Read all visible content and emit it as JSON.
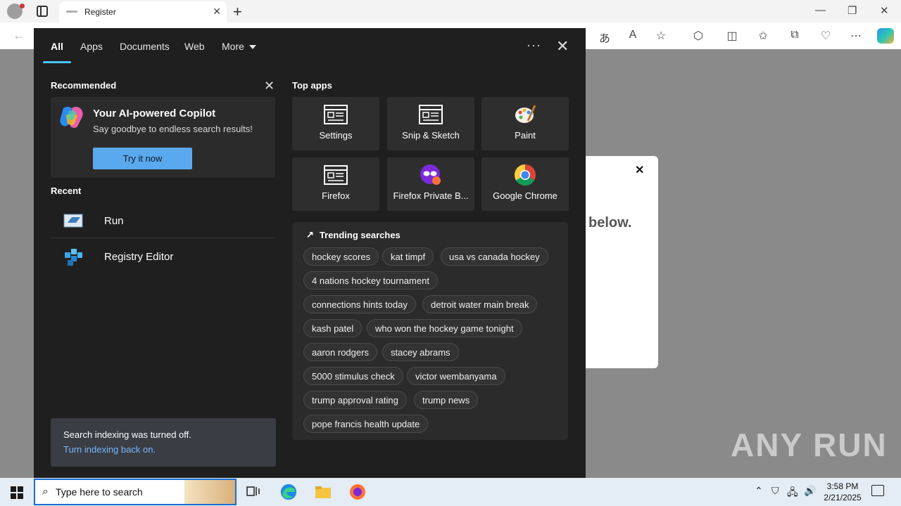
{
  "browser": {
    "tab_title": "Register",
    "colors": {
      "titlebar": "#f3f3f3",
      "toolbar": "#ffffff"
    }
  },
  "page": {
    "partial_heading": "below.",
    "close_glyph": "✕"
  },
  "search_flyout": {
    "tabs": [
      {
        "label": "All",
        "active": true
      },
      {
        "label": "Apps"
      },
      {
        "label": "Documents"
      },
      {
        "label": "Web"
      },
      {
        "label": "More"
      }
    ],
    "recommended": {
      "heading": "Recommended",
      "title": "Your AI-powered Copilot",
      "subtitle": "Say goodbye to endless search results!",
      "button_label": "Try it now"
    },
    "recent": {
      "heading": "Recent",
      "items": [
        {
          "label": "Run",
          "icon": "run-icon"
        },
        {
          "label": "Registry Editor",
          "icon": "registry-editor-icon"
        }
      ]
    },
    "indexing": {
      "message": "Search indexing was turned off.",
      "link": "Turn indexing back on."
    },
    "top_apps": {
      "heading": "Top apps",
      "items": [
        {
          "label": "Settings",
          "icon": "window-icon"
        },
        {
          "label": "Snip & Sketch",
          "icon": "window-icon"
        },
        {
          "label": "Paint",
          "icon": "paint-palette-icon"
        },
        {
          "label": "Firefox",
          "icon": "window-icon"
        },
        {
          "label": "Firefox Private B...",
          "icon": "firefox-private-icon"
        },
        {
          "label": "Google Chrome",
          "icon": "chrome-icon"
        }
      ]
    },
    "trending": {
      "heading": "Trending searches",
      "chips": [
        "hockey scores",
        "kat timpf",
        "usa vs canada hockey",
        "4 nations hockey tournament",
        "connections hints today",
        "detroit water main break",
        "kash patel",
        "who won the hockey game tonight",
        "aaron rodgers",
        "stacey abrams",
        "5000 stimulus check",
        "victor wembanyama",
        "trump approval rating",
        "trump news",
        "pope francis health update"
      ]
    }
  },
  "taskbar": {
    "search_placeholder": "Type here to search",
    "time": "3:58 PM",
    "date": "2/21/2025"
  },
  "watermark": "ANY RUN"
}
